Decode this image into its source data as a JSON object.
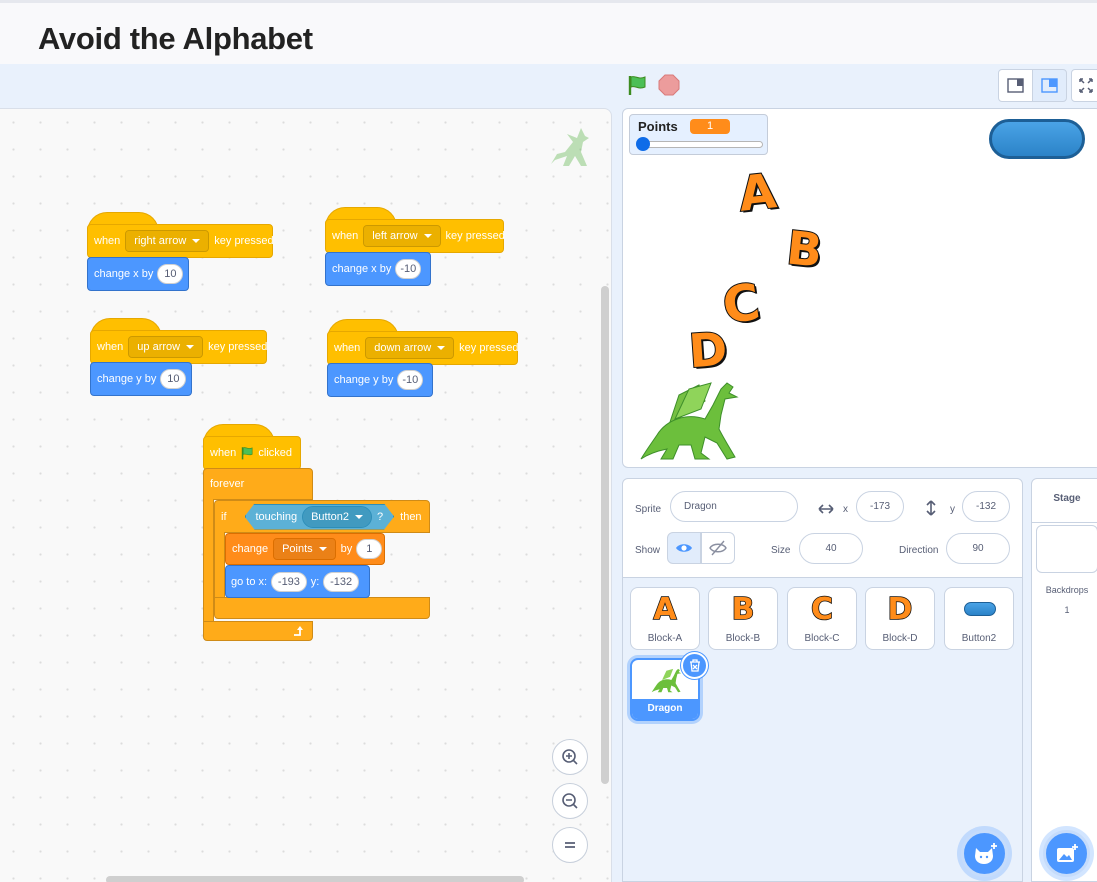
{
  "header": {
    "title": "Avoid the Alphabet"
  },
  "colors": {
    "event": "#ffbf00",
    "motion": "#4c97ff",
    "control": "#ffab19",
    "variables": "#ff8c1a",
    "sensing": "#5cb1d6",
    "accent": "#4c97ff"
  },
  "scripts": {
    "s1": {
      "when": "when",
      "key": "right arrow",
      "pressed": "key pressed",
      "action": "change x by",
      "value": "10"
    },
    "s2": {
      "when": "when",
      "key": "left arrow",
      "pressed": "key pressed",
      "action": "change x by",
      "value": "-10"
    },
    "s3": {
      "when": "when",
      "key": "up arrow",
      "pressed": "key pressed",
      "action": "change y by",
      "value": "10"
    },
    "s4": {
      "when": "when",
      "key": "down arrow",
      "pressed": "key pressed",
      "action": "change y by",
      "value": "-10"
    },
    "s5": {
      "when": "when",
      "clicked": "clicked",
      "forever": "forever",
      "if": "if",
      "touching": "touching",
      "touching_target": "Button2",
      "question": "?",
      "then": "then",
      "change": "change",
      "variable": "Points",
      "by": "by",
      "by_value": "1",
      "goto": "go to x:",
      "x": "-193",
      "y_label": "y:",
      "y": "-132"
    }
  },
  "stage": {
    "monitor": {
      "label": "Points",
      "value": "1",
      "slider_fraction": 0.0
    },
    "letters": [
      "A",
      "B",
      "C",
      "D"
    ]
  },
  "sprite_info": {
    "sprite_label": "Sprite",
    "sprite_name": "Dragon",
    "x_label": "x",
    "x": "-173",
    "y_label": "y",
    "y": "-132",
    "show_label": "Show",
    "size_label": "Size",
    "size": "40",
    "direction_label": "Direction",
    "direction": "90"
  },
  "sprites": [
    {
      "name": "Block-A",
      "glyph": "A"
    },
    {
      "name": "Block-B",
      "glyph": "B"
    },
    {
      "name": "Block-C",
      "glyph": "C"
    },
    {
      "name": "Block-D",
      "glyph": "D"
    },
    {
      "name": "Button2",
      "glyph": ""
    },
    {
      "name": "Dragon",
      "glyph": ""
    }
  ],
  "stage_pane": {
    "title": "Stage",
    "backdrops_label": "Backdrops",
    "backdrops_count": "1"
  },
  "icons": {
    "green_flag": "green-flag-icon",
    "stop": "stop-icon",
    "zoom_in": "zoom-in-icon",
    "zoom_out": "zoom-out-icon",
    "zoom_reset": "zoom-reset-icon",
    "choose_sprite": "choose-sprite-icon",
    "choose_backdrop": "choose-backdrop-icon"
  }
}
